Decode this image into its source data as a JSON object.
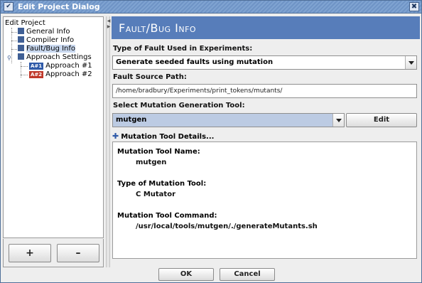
{
  "window": {
    "title": "Edit Project Dialog",
    "menu_glyph": "✔",
    "close_glyph": "✖"
  },
  "tree": {
    "root": "Edit Project",
    "items": [
      {
        "label": "General Info"
      },
      {
        "label": "Compiler Info"
      },
      {
        "label": "Fault/Bug Info"
      },
      {
        "label": "Approach Settings"
      }
    ],
    "approaches": [
      {
        "badge": "A#1",
        "label": "Approach #1"
      },
      {
        "badge": "A#2",
        "label": "Approach #2"
      }
    ],
    "add_label": "+",
    "remove_label": "–"
  },
  "panel": {
    "title": "Fault/Bug Info",
    "fault_type_label": "Type of Fault Used in Experiments:",
    "fault_type_value": "Generate seeded faults using mutation",
    "source_path_label": "Fault Source Path:",
    "source_path_value": "/home/bradbury/Experiments/print_tokens/mutants/",
    "tool_label": "Select Mutation Generation Tool:",
    "tool_value": "mutgen",
    "edit_label": "Edit",
    "details_toggle": "Mutation Tool Details...",
    "details": {
      "name_label": "Mutation Tool Name:",
      "name_value": "mutgen",
      "type_label": "Type of Mutation Tool:",
      "type_value": "C Mutator",
      "command_label": "Mutation Tool Command:",
      "command_value": "/usr/local/tools/mutgen/./generateMutants.sh"
    }
  },
  "footer": {
    "ok_label": "OK",
    "cancel_label": "Cancel"
  },
  "colors": {
    "header": "#577dba",
    "titlebar": "#7fa3d1",
    "selection": "#bccbe3"
  }
}
